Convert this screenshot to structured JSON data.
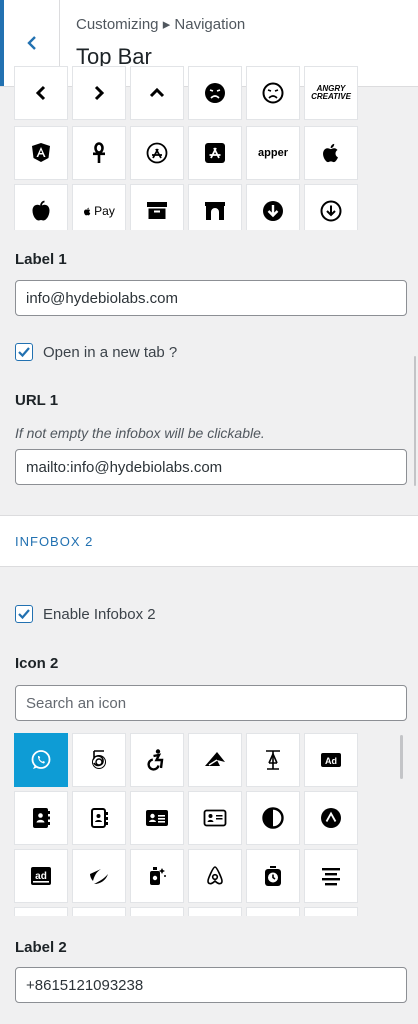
{
  "header": {
    "breadcrumb": "Customizing ▸ Navigation",
    "title": "Top Bar"
  },
  "icons_top": [
    "chevron-left",
    "chevron-right",
    "chevron-up",
    "angry-face",
    "angry-face-outline",
    "angrycreative",
    "angular",
    "ankh",
    "app-store",
    "app-store-ios",
    "appernetic",
    "apple",
    "apple-alt",
    "apple-pay",
    "archive",
    "archway",
    "arrow-circle-down",
    "arrow-circle-down-outline"
  ],
  "icon_text": {
    "angrycreative": "ANGRY CREATIVE",
    "appernetic": "apper",
    "apple_pay": "Pay"
  },
  "label1": {
    "title": "Label 1",
    "value": "info@hydebiolabs.com"
  },
  "new_tab": {
    "label": "Open in a new tab ?",
    "checked": true
  },
  "url1": {
    "title": "URL 1",
    "description": "If not empty the infobox will be clickable.",
    "value": "mailto:info@hydebiolabs.com"
  },
  "infobox2": {
    "section_title": "INFOBOX 2",
    "enable_label": "Enable Infobox 2",
    "enabled": true,
    "icon_title": "Icon 2",
    "search_placeholder": "Search an icon",
    "selected_icon": "whatsapp"
  },
  "icons_bottom": [
    "whatsapp",
    "500px",
    "accessible",
    "accusoft",
    "acquisitions-incorporated",
    "ad",
    "address-book",
    "address-book-outline",
    "address-card",
    "address-card-outline",
    "adjust",
    "adn",
    "adversal",
    "affiliatetheme",
    "air-freshener",
    "airbnb",
    "alarm",
    "align-center"
  ],
  "label2": {
    "title": "Label 2",
    "value": "+8615121093238"
  },
  "colors": {
    "accent": "#2271b1",
    "selected_icon_bg": "#0e9cd5"
  }
}
